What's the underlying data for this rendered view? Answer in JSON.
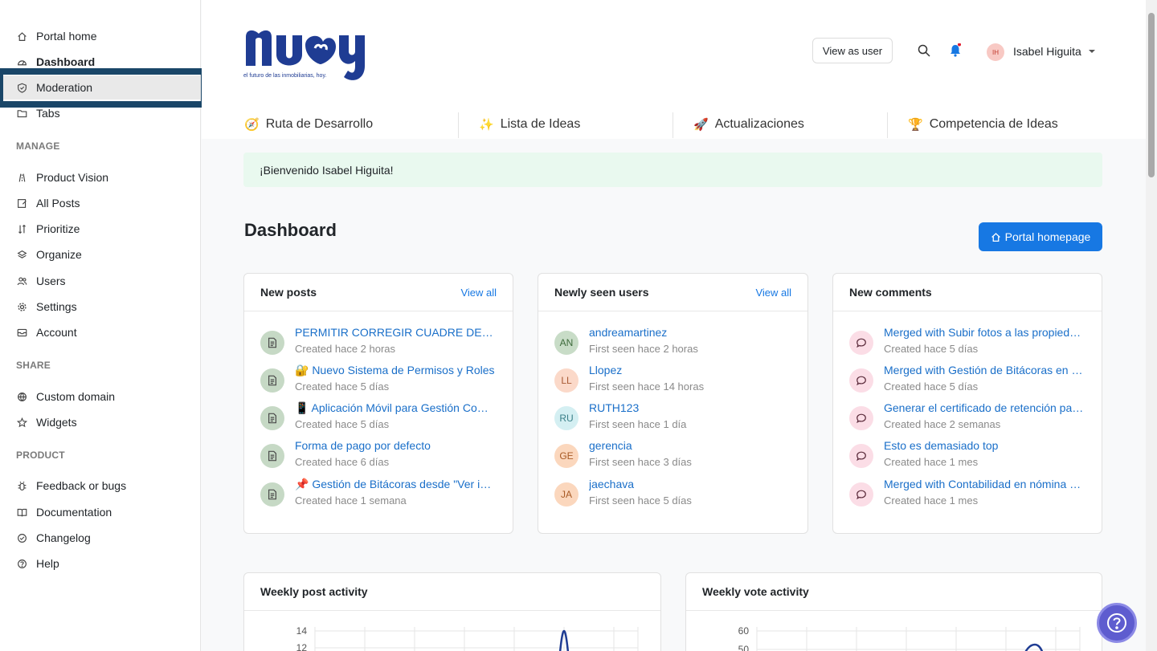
{
  "sidebar": {
    "items": [
      {
        "label": "Portal home"
      },
      {
        "label": "Dashboard"
      },
      {
        "label": "Moderation"
      },
      {
        "label": "Tabs"
      }
    ],
    "manage_label": "MANAGE",
    "manage_items": [
      {
        "label": "Product Vision"
      },
      {
        "label": "All Posts"
      },
      {
        "label": "Prioritize"
      },
      {
        "label": "Organize"
      },
      {
        "label": "Users"
      },
      {
        "label": "Settings"
      },
      {
        "label": "Account"
      }
    ],
    "share_label": "SHARE",
    "share_items": [
      {
        "label": "Custom domain"
      },
      {
        "label": "Widgets"
      }
    ],
    "product_label": "PRODUCT",
    "product_items": [
      {
        "label": "Feedback or bugs"
      },
      {
        "label": "Documentation"
      },
      {
        "label": "Changelog"
      },
      {
        "label": "Help"
      }
    ]
  },
  "header": {
    "logo_text": "nuby",
    "logo_tagline": "el futuro de las inmobiliarias, hoy.",
    "view_as_user": "View as user",
    "user_initials": "IH",
    "user_name": "Isabel Higuita",
    "tabs": [
      {
        "emoji": "🧭",
        "label": "Ruta de Desarrollo"
      },
      {
        "emoji": "✨",
        "label": "Lista de Ideas"
      },
      {
        "emoji": "🚀",
        "label": "Actualizaciones"
      },
      {
        "emoji": "🏆",
        "label": "Competencia de Ideas"
      }
    ]
  },
  "main": {
    "welcome": "¡Bienvenido Isabel Higuita!",
    "title": "Dashboard",
    "portal_homepage": "Portal homepage",
    "new_posts": {
      "title": "New posts",
      "link": "View all",
      "items": [
        {
          "title": "PERMITIR CORREGIR CUADRE DE CAJA",
          "sub": "Created hace 2 horas"
        },
        {
          "title": "🔐 Nuevo Sistema de Permisos y Roles",
          "sub": "Created hace 5 días"
        },
        {
          "title": "📱 Aplicación Móvil para Gestión Comercial",
          "sub": "Created hace 5 días"
        },
        {
          "title": "Forma de pago por defecto",
          "sub": "Created hace 6 días"
        },
        {
          "title": "📌 Gestión de Bitácoras desde \"Ver inmueble\"",
          "sub": "Created hace 1 semana"
        }
      ]
    },
    "new_users": {
      "title": "Newly seen users",
      "link": "View all",
      "items": [
        {
          "initials": "AN",
          "name": "andreamartinez",
          "sub": "First seen hace 2 horas",
          "bg": "#c8dcc7",
          "fg": "#3e6b3c"
        },
        {
          "initials": "LL",
          "name": "Llopez",
          "sub": "First seen hace 14 horas",
          "bg": "#fbd9c9",
          "fg": "#a85a34"
        },
        {
          "initials": "RU",
          "name": "RUTH123",
          "sub": "First seen hace 1 día",
          "bg": "#d4eff2",
          "fg": "#3a7f88"
        },
        {
          "initials": "GE",
          "name": "gerencia",
          "sub": "First seen hace 3 días",
          "bg": "#fbd7bd",
          "fg": "#a85a25"
        },
        {
          "initials": "JA",
          "name": "jaechava",
          "sub": "First seen hace 5 días",
          "bg": "#fbd7bd",
          "fg": "#a85a25"
        }
      ]
    },
    "new_comments": {
      "title": "New comments",
      "items": [
        {
          "title": "Merged with Subir fotos a las propiedades",
          "sub": "Created hace 5 días"
        },
        {
          "title": "Merged with Gestión de Bitácoras en inmuebles",
          "sub": "Created hace 5 días"
        },
        {
          "title": "Generar el certificado de retención para propietarios",
          "sub": "Created hace 2 semanas"
        },
        {
          "title": "Esto es demasiado top",
          "sub": "Created hace 1 mes"
        },
        {
          "title": "Merged with Contabilidad en nómina electrónica",
          "sub": "Created hace 1 mes"
        }
      ]
    },
    "weekly_post": {
      "title": "Weekly post activity",
      "ticks": [
        "14",
        "12"
      ]
    },
    "weekly_vote": {
      "title": "Weekly vote activity",
      "ticks": [
        "60",
        "50"
      ]
    }
  },
  "colors": {
    "primary": "#1778e3",
    "link": "#1a6fc9",
    "highlight_border": "#1a4668",
    "banner": "#e9f9ef",
    "brand": "#1f3c93"
  }
}
